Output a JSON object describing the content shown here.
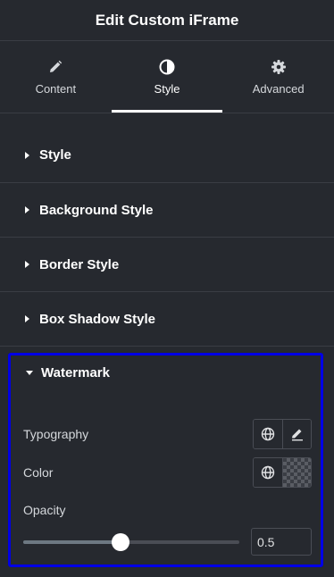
{
  "header": {
    "title": "Edit Custom iFrame"
  },
  "tabs": [
    {
      "label": "Content",
      "icon": "pencil-icon"
    },
    {
      "label": "Style",
      "icon": "half-circle-icon",
      "active": true
    },
    {
      "label": "Advanced",
      "icon": "gear-icon"
    }
  ],
  "sections": [
    {
      "title": "Style"
    },
    {
      "title": "Background Style"
    },
    {
      "title": "Border Style"
    },
    {
      "title": "Box Shadow Style"
    }
  ],
  "watermark": {
    "title": "Watermark",
    "typography_label": "Typography",
    "color_label": "Color",
    "opacity_label": "Opacity",
    "opacity_value": "0.5",
    "opacity_fraction": 0.45,
    "highlight_color": "#0000e6"
  }
}
